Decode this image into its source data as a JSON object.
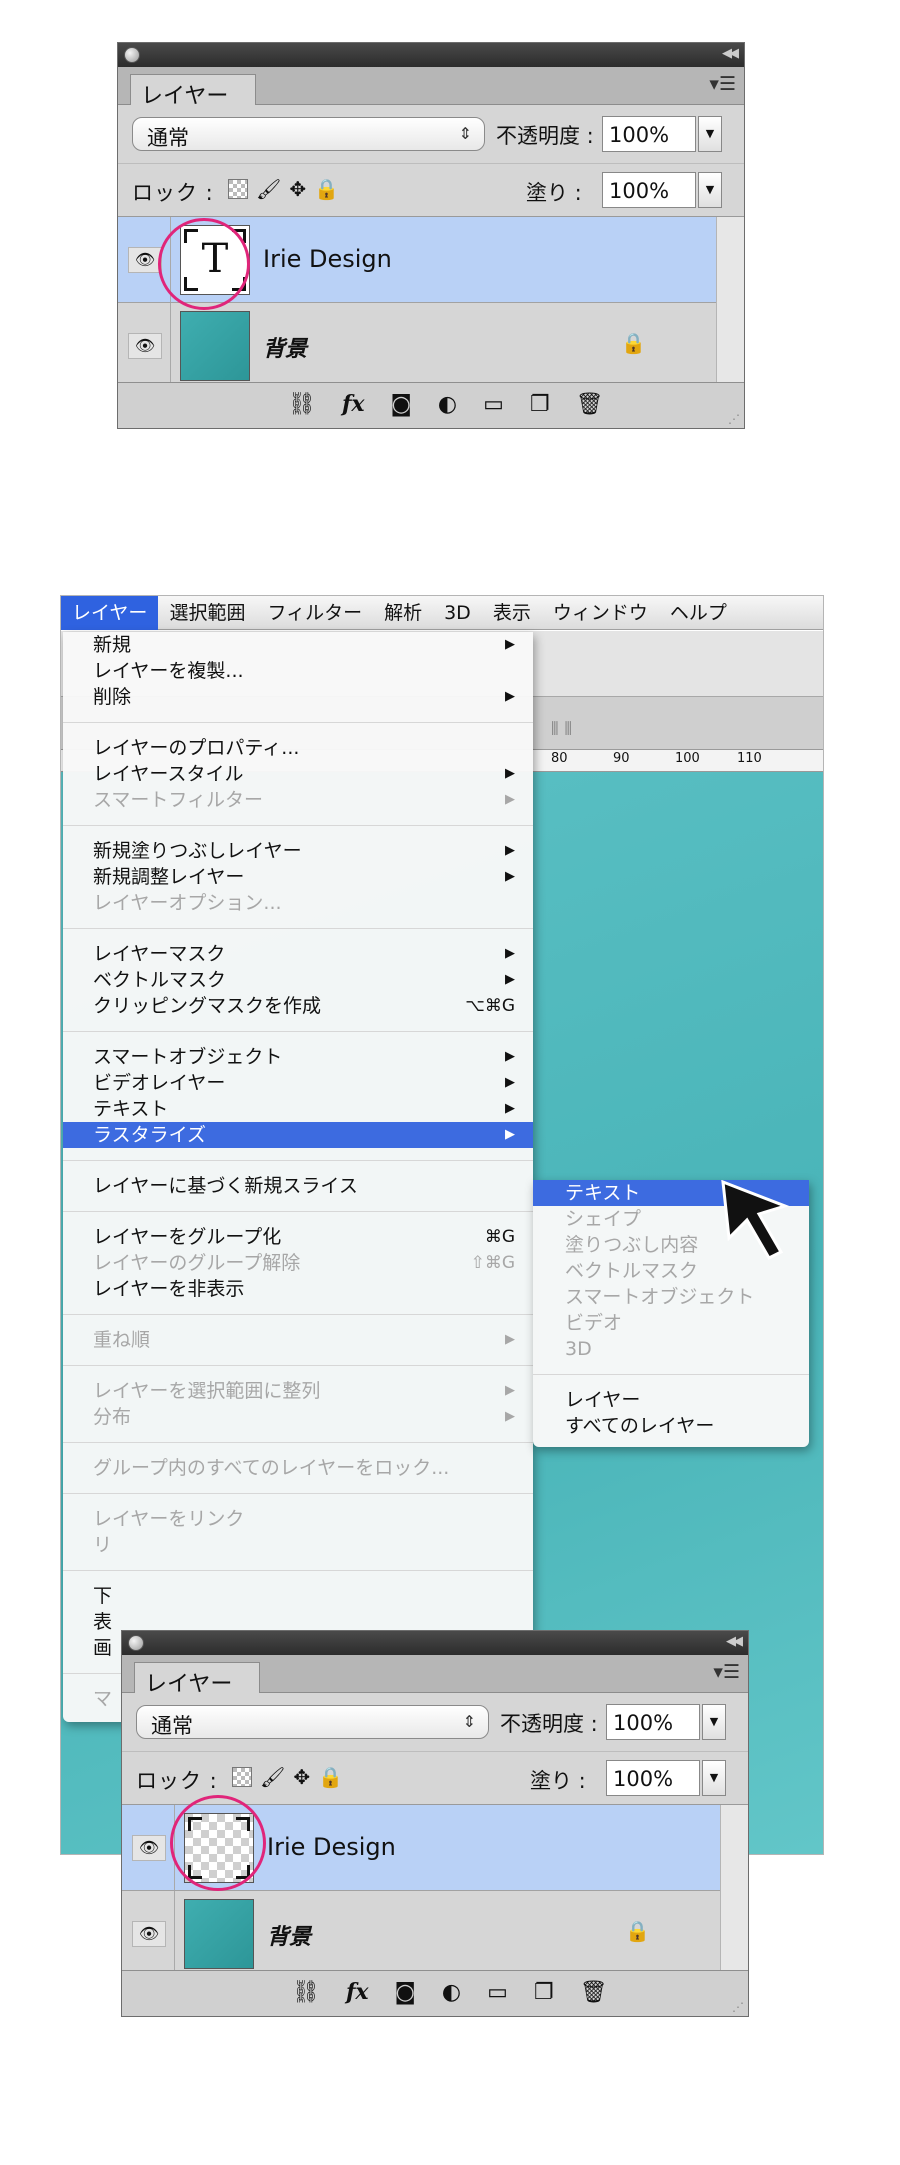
{
  "panel_top": {
    "tab_label": "レイヤー",
    "blend_mode": "通常",
    "opacity_label": "不透明度 :",
    "opacity_value": "100%",
    "lock_label": "ロック :",
    "fill_label": "塗り :",
    "fill_value": "100%",
    "layers": [
      {
        "name": "Irie Design",
        "thumb_letter": "T",
        "selected": true
      },
      {
        "name": "背景",
        "locked": true
      }
    ]
  },
  "menubar": {
    "items": [
      "レイヤー",
      "選択範囲",
      "フィルター",
      "解析",
      "3D",
      "表示",
      "ウィンドウ",
      "ヘルプ"
    ]
  },
  "ruler_ticks": [
    "80",
    "90",
    "100",
    "110"
  ],
  "layer_menu": {
    "groups": [
      [
        {
          "label": "新規",
          "submenu": true
        },
        {
          "label": "レイヤーを複製..."
        },
        {
          "label": "削除",
          "submenu": true
        }
      ],
      [
        {
          "label": "レイヤーのプロパティ..."
        },
        {
          "label": "レイヤースタイル",
          "submenu": true
        },
        {
          "label": "スマートフィルター",
          "submenu": true,
          "disabled": true
        }
      ],
      [
        {
          "label": "新規塗りつぶしレイヤー",
          "submenu": true
        },
        {
          "label": "新規調整レイヤー",
          "submenu": true
        },
        {
          "label": "レイヤーオプション...",
          "disabled": true
        }
      ],
      [
        {
          "label": "レイヤーマスク",
          "submenu": true
        },
        {
          "label": "ベクトルマスク",
          "submenu": true
        },
        {
          "label": "クリッピングマスクを作成",
          "shortcut": "⌥⌘G"
        }
      ],
      [
        {
          "label": "スマートオブジェクト",
          "submenu": true
        },
        {
          "label": "ビデオレイヤー",
          "submenu": true
        },
        {
          "label": "テキスト",
          "submenu": true
        },
        {
          "label": "ラスタライズ",
          "submenu": true,
          "highlighted": true
        }
      ],
      [
        {
          "label": "レイヤーに基づく新規スライス"
        }
      ],
      [
        {
          "label": "レイヤーをグループ化",
          "shortcut": "⌘G"
        },
        {
          "label": "レイヤーのグループ解除",
          "shortcut": "⇧⌘G",
          "disabled": true
        },
        {
          "label": "レイヤーを非表示"
        }
      ],
      [
        {
          "label": "重ね順",
          "submenu": true,
          "disabled": true
        }
      ],
      [
        {
          "label": "レイヤーを選択範囲に整列",
          "submenu": true,
          "disabled": true
        },
        {
          "label": "分布",
          "submenu": true,
          "disabled": true
        }
      ],
      [
        {
          "label": "グループ内のすべてのレイヤーをロック...",
          "disabled": true
        }
      ],
      [
        {
          "label": "レイヤーをリンク",
          "disabled": true
        },
        {
          "label": "リ",
          "disabled": true
        }
      ],
      [
        {
          "label": "下"
        },
        {
          "label": "表"
        },
        {
          "label": "画"
        }
      ],
      [
        {
          "label": "マ",
          "disabled": true
        }
      ]
    ]
  },
  "rasterize_submenu": {
    "groups": [
      [
        {
          "label": "テキスト",
          "highlighted": true
        },
        {
          "label": "シェイプ",
          "disabled": true
        },
        {
          "label": "塗りつぶし内容",
          "disabled": true
        },
        {
          "label": "ベクトルマスク",
          "disabled": true
        },
        {
          "label": "スマートオブジェクト",
          "disabled": true
        },
        {
          "label": "ビデオ",
          "disabled": true
        },
        {
          "label": "3D",
          "disabled": true
        }
      ],
      [
        {
          "label": "レイヤー"
        },
        {
          "label": "すべてのレイヤー"
        }
      ]
    ]
  },
  "panel_bottom": {
    "tab_label": "レイヤー",
    "blend_mode": "通常",
    "opacity_label": "不透明度 :",
    "opacity_value": "100%",
    "lock_label": "ロック :",
    "fill_label": "塗り :",
    "fill_value": "100%",
    "layers": [
      {
        "name": "Irie Design",
        "selected": true
      },
      {
        "name": "背景",
        "locked": true
      }
    ]
  },
  "colors": {
    "highlight": "#3d6be0",
    "selected_layer": "#b9d1f6",
    "annotation_circle": "#e0257a",
    "canvas_teal": "#4fb9bc"
  }
}
